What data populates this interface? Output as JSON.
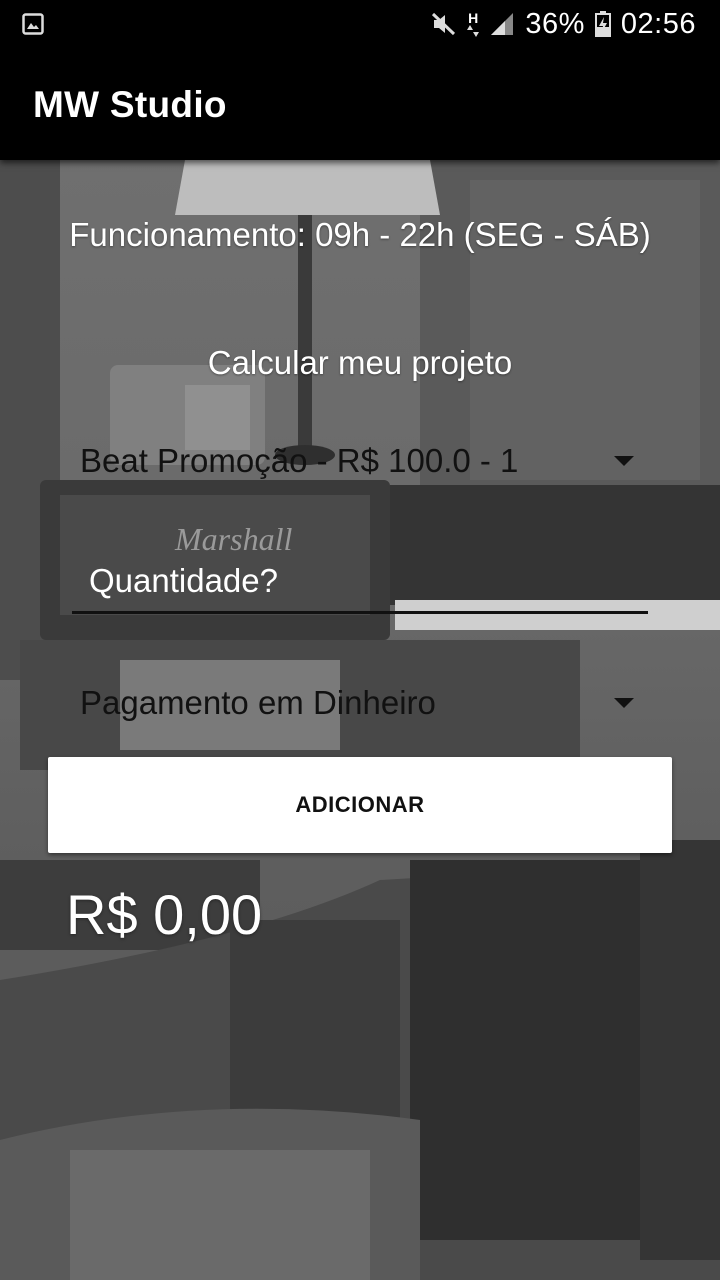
{
  "status_bar": {
    "battery": "36%",
    "time": "02:56",
    "network_label": "H",
    "icons": [
      "gallery-icon",
      "mute-icon",
      "data-arrows-icon",
      "signal-icon",
      "battery-icon"
    ]
  },
  "app_bar": {
    "title": "MW Studio"
  },
  "main": {
    "hours_text": "Funcionamento: 09h - 22h (SEG - SÁB)",
    "calc_title": "Calcular meu projeto",
    "service_select": {
      "value": "Beat Promoção - R$ 100.0 - 1"
    },
    "quantity_input": {
      "value": "",
      "placeholder": "Quantidade?"
    },
    "payment_select": {
      "value": "Pagamento em Dinheiro"
    },
    "add_button_label": "ADICIONAR",
    "total": "R$ 0,00"
  },
  "colors": {
    "app_bar": "#000000",
    "button_bg": "#ffffff",
    "text_light": "#ffffff",
    "text_dark": "#111111"
  }
}
